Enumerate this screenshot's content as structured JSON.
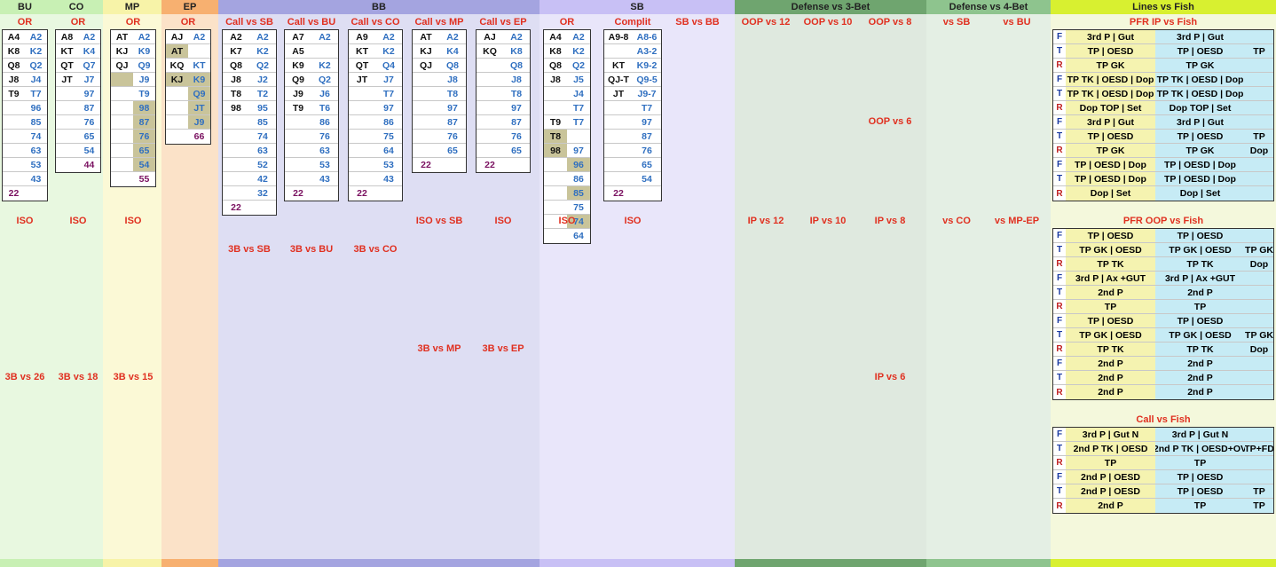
{
  "headers": [
    {
      "label": "BU",
      "color": "#c8f0b4"
    },
    {
      "label": "CO",
      "color": "#c8f0b4"
    },
    {
      "label": "MP",
      "color": "#f7f3a8"
    },
    {
      "label": "EP",
      "color": "#f7b070"
    },
    {
      "label": "BB",
      "color": "#a4a4e0"
    },
    {
      "label": "SB",
      "color": "#c8c0f5"
    },
    {
      "label": "Defense vs 3-Bet",
      "color": "#6fa56f"
    },
    {
      "label": "Defense vs 4-Bet",
      "color": "#8ec48e"
    },
    {
      "label": "Lines vs Fish",
      "color": "#d8f030"
    }
  ],
  "columns": {
    "bu_or": {
      "title": "OR",
      "rows": [
        [
          "A4",
          "A2"
        ],
        [
          "K8",
          "K2"
        ],
        [
          "Q8",
          "Q2"
        ],
        [
          "J8",
          "J4"
        ],
        [
          "T9",
          "T7"
        ],
        [
          "",
          "96"
        ],
        [
          "",
          "85"
        ],
        [
          "",
          "74"
        ],
        [
          "",
          "63"
        ],
        [
          "",
          "53"
        ],
        [
          "",
          "43"
        ],
        [
          "22",
          ""
        ]
      ]
    },
    "co_or": {
      "title": "OR",
      "rows": [
        [
          "A8",
          "A2"
        ],
        [
          "KT",
          "K4"
        ],
        [
          "QT",
          "Q7"
        ],
        [
          "JT",
          "J7"
        ],
        [
          "",
          "97"
        ],
        [
          "",
          "87"
        ],
        [
          "",
          "76"
        ],
        [
          "",
          "65"
        ],
        [
          "",
          "54"
        ],
        [
          "",
          "44"
        ]
      ]
    },
    "mp_or": {
      "title": "OR",
      "rows": [
        [
          "AT",
          "A2"
        ],
        [
          "KJ",
          "K9"
        ],
        [
          "QJ",
          "Q9"
        ],
        [
          "",
          "J9"
        ],
        [
          "",
          "T9"
        ],
        [
          "",
          "98"
        ],
        [
          "",
          "87"
        ],
        [
          "",
          "76"
        ],
        [
          "",
          "65"
        ],
        [
          "",
          "54"
        ],
        [
          "",
          "55"
        ]
      ]
    },
    "ep_or": {
      "title": "OR",
      "rows": [
        [
          "AJ",
          "A2"
        ],
        [
          "AT",
          ""
        ],
        [
          "KQ",
          "KT"
        ],
        [
          "KJ",
          "K9"
        ],
        [
          "",
          "Q9"
        ],
        [
          "",
          "JT"
        ],
        [
          "",
          "J9"
        ],
        [
          "",
          "66"
        ]
      ]
    },
    "bb_call_sb": {
      "title": "Call vs SB",
      "rows": [
        [
          "A2",
          "A2"
        ],
        [
          "K7",
          "K2"
        ],
        [
          "Q8",
          "Q2"
        ],
        [
          "J8",
          "J2"
        ],
        [
          "T8",
          "T2"
        ],
        [
          "98",
          "95"
        ],
        [
          "",
          "85"
        ],
        [
          "",
          "74"
        ],
        [
          "",
          "63"
        ],
        [
          "",
          "52"
        ],
        [
          "",
          "42"
        ],
        [
          "",
          "32"
        ],
        [
          "22",
          ""
        ]
      ]
    },
    "bb_call_bu": {
      "title": "Call vs BU",
      "rows": [
        [
          "A7",
          "A2"
        ],
        [
          "A5",
          ""
        ],
        [
          "K9",
          "K2"
        ],
        [
          "Q9",
          "Q2"
        ],
        [
          "J9",
          "J6"
        ],
        [
          "T9",
          "T6"
        ],
        [
          "",
          "86"
        ],
        [
          "",
          "76"
        ],
        [
          "",
          "63"
        ],
        [
          "",
          "53"
        ],
        [
          "",
          "43"
        ],
        [
          "22",
          ""
        ]
      ]
    },
    "bb_call_co": {
      "title": "Call vs CO",
      "rows": [
        [
          "A9",
          "A2"
        ],
        [
          "KT",
          "K2"
        ],
        [
          "QT",
          "Q4"
        ],
        [
          "JT",
          "J7"
        ],
        [
          "",
          "T7"
        ],
        [
          "",
          "97"
        ],
        [
          "",
          "86"
        ],
        [
          "",
          "75"
        ],
        [
          "",
          "64"
        ],
        [
          "",
          "53"
        ],
        [
          "",
          "43"
        ],
        [
          "22",
          ""
        ]
      ]
    },
    "bb_call_mp": {
      "title": "Call vs MP",
      "rows": [
        [
          "AT",
          "A2"
        ],
        [
          "KJ",
          "K4"
        ],
        [
          "QJ",
          "Q8"
        ],
        [
          "",
          "J8"
        ],
        [
          "",
          "T8"
        ],
        [
          "",
          "97"
        ],
        [
          "",
          "87"
        ],
        [
          "",
          "76"
        ],
        [
          "",
          "65"
        ],
        [
          "22",
          ""
        ]
      ]
    },
    "bb_call_ep": {
      "title": "Call vs EP",
      "rows": [
        [
          "AJ",
          "A2"
        ],
        [
          "KQ",
          "K8"
        ],
        [
          "",
          "Q8"
        ],
        [
          "",
          "J8"
        ],
        [
          "",
          "T8"
        ],
        [
          "",
          "97"
        ],
        [
          "",
          "87"
        ],
        [
          "",
          "76"
        ],
        [
          "",
          "65"
        ],
        [
          "22",
          ""
        ]
      ]
    },
    "sb_or": {
      "title": "OR",
      "rows": [
        [
          "A4",
          "A2"
        ],
        [
          "K8",
          "K2"
        ],
        [
          "Q8",
          "Q2"
        ],
        [
          "J8",
          "J5"
        ],
        [
          "",
          "J4"
        ],
        [
          "",
          "T7"
        ],
        [
          "T9",
          "T7"
        ],
        [
          "T8",
          ""
        ],
        [
          "98",
          "97"
        ],
        [
          "",
          "96"
        ],
        [
          "",
          "86"
        ],
        [
          "",
          "85"
        ],
        [
          "",
          "75"
        ],
        [
          "",
          "74"
        ],
        [
          "",
          "64"
        ]
      ]
    },
    "sb_complit": {
      "title": "Complit",
      "rows": [
        [
          "A9-8",
          "A8-6"
        ],
        [
          "",
          "A3-2"
        ],
        [
          "KT",
          "K9-2"
        ],
        [
          "QJ-T",
          "Q9-5"
        ],
        [
          "JT",
          "J9-7"
        ],
        [
          "",
          "T7"
        ],
        [
          "",
          "97"
        ],
        [
          "",
          "87"
        ],
        [
          "",
          "76"
        ],
        [
          "",
          "65"
        ],
        [
          "",
          "54"
        ],
        [
          "22",
          ""
        ]
      ]
    },
    "sb_vs_bb": {
      "title": "SB vs BB"
    }
  },
  "fish": {
    "pfr_ip": {
      "title": "PFR IP vs Fish"
    },
    "pfr_oop": {
      "title": "PFR OOP vs Fish"
    },
    "call": {
      "title": "Call vs Fish"
    },
    "labels": {
      "f": "F",
      "t": "T",
      "r": "R"
    },
    "cells": {
      "p3gut": "3rd P | Gut",
      "tpoesd": "TP | OESD",
      "tp": "TP",
      "tpgk": "TP GK",
      "dop": "Dop",
      "tptk_oesd_dop": "TP TK | OESD | Dop",
      "r_set": "Dop TOP | Set",
      "tp_oesd_dop": "TP | OESD | Dop",
      "dop_set": "Dop | Set",
      "tpgk_oesd": "TP GK | OESD",
      "tptk": "TP TK",
      "p3ax": "3rd P | Ax +GUT",
      "p2": "2nd P",
      "p3gutn": "3rd P | Gut N",
      "p2tk_oesd": "2nd P TK | OESD",
      "p2tk_oesdov": "2nd P TK | OESD+OV",
      "tpfd": "TP+FD",
      "p2_oesd": "2nd P | OESD"
    }
  },
  "bottom_counts": {
    "bu": "22",
    "co": "44",
    "mp": "55",
    "ep": "66"
  },
  "section_titles": {
    "iso": "ISO",
    "b3_26": "3B vs 26",
    "b3_18": "3B vs 18",
    "b3_15": "3B vs 15",
    "b3sb": "3B vs SB",
    "b3bu": "3B vs BU",
    "b3co": "3B vs CO",
    "isosb": "ISO vs SB",
    "b3mp": "3B vs MP",
    "b3ep": "3B vs EP",
    "oop12": "OOP vs 12",
    "oop10": "OOP vs 10",
    "oop8": "OOP vs 8",
    "oop6": "OOP vs 6",
    "ip12": "IP vs 12",
    "ip10": "IP vs 10",
    "ip8": "IP vs 8",
    "ip6": "IP vs 6",
    "vssb": "vs SB",
    "vsbu": "vs BU",
    "vsco": "vs CO",
    "vsmpep": "vs MP-EP"
  }
}
